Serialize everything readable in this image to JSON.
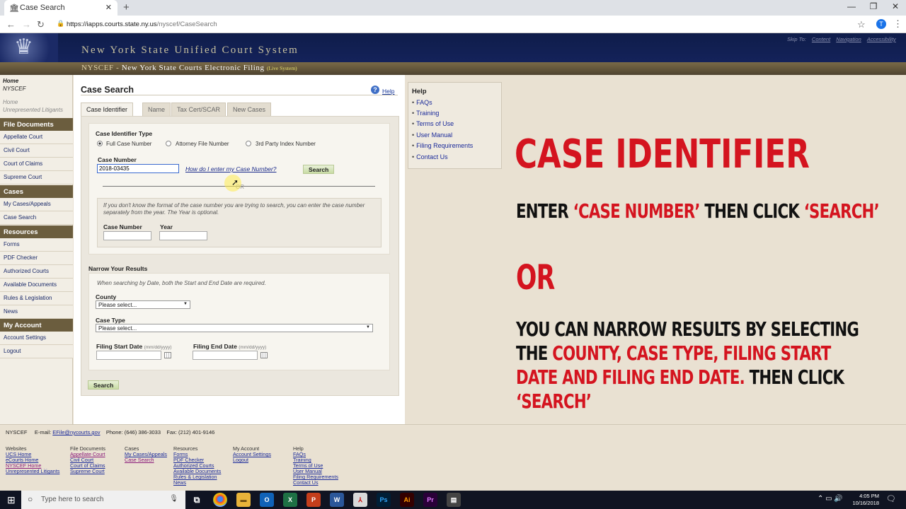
{
  "browser": {
    "tab_title": "Case Search",
    "tab_close": "✕",
    "new_tab": "+",
    "url_host": "https://iapps.courts.state.ny.us",
    "url_path": "/nyscef/CaseSearch",
    "avatar_letter": "T",
    "win_min": "—",
    "win_max": "❐",
    "win_close": "✕"
  },
  "header": {
    "site_title": "New York State Unified Court System",
    "skip_label": "Skip To:",
    "skip_links": [
      "Content",
      "Navigation",
      "Accessibility"
    ],
    "nyscef": "NYSCEF",
    "dash": " - ",
    "subtitle": "New York State Courts Electronic Filing",
    "live": "(Live System)"
  },
  "sidebar": {
    "home": "Home",
    "nyscef": "NYSCEF",
    "home2": "Home",
    "unrep": "Unrepresented Litigants",
    "sections": [
      {
        "title": "File Documents",
        "items": [
          "Appellate Court",
          "Civil Court",
          "Court of Claims",
          "Supreme Court"
        ]
      },
      {
        "title": "Cases",
        "items": [
          "My Cases/Appeals",
          "Case Search"
        ]
      },
      {
        "title": "Resources",
        "items": [
          "Forms",
          "PDF Checker",
          "Authorized Courts",
          "Available Documents",
          "Rules & Legislation",
          "News"
        ]
      },
      {
        "title": "My Account",
        "items": [
          "Account Settings",
          "Logout"
        ]
      }
    ]
  },
  "main": {
    "title": "Case Search",
    "help": "Help",
    "tabs": [
      "Case Identifier",
      "Name",
      "Tax Cert/SCAR",
      "New Cases"
    ],
    "id_type_label": "Case Identifier Type",
    "radios": [
      "Full Case Number",
      "Attorney File Number",
      "3rd Party Index Number"
    ],
    "case_number_label": "Case Number",
    "case_number_value": "2018-03435",
    "how_do": "How do I enter my Case Number?",
    "search": "Search",
    "or": "OR",
    "note": "If you don't know the format of the case number you are trying to search, you can enter the case number separately from the year. The Year is optional.",
    "case_number2": "Case Number",
    "year": "Year",
    "narrow": "Narrow Your Results",
    "narrow_note": "When searching by Date, both the Start and End Date are required.",
    "county": "County",
    "county_value": "Please select...",
    "case_type": "Case Type",
    "case_type_value": "Please select...",
    "start_date": "Filing Start Date",
    "end_date": "Filing End Date",
    "date_hint": "(mm/dd/yyyy)",
    "search_bottom": "Search"
  },
  "help_box": {
    "title": "Help",
    "links": [
      "FAQs",
      "Training",
      "Terms of Use",
      "User Manual",
      "Filing Requirements",
      "Contact Us"
    ]
  },
  "overlay": {
    "title": "CASE IDENTIFIER",
    "l1a": "ENTER ",
    "l1b": "‘CASE NUMBER’",
    "l1c": " THEN CLICK ",
    "l1d": "‘SEARCH’",
    "or": "OR",
    "p1": "YOU CAN NARROW RESULTS BY SELECTING THE ",
    "p2": "COUNTY, CASE TYPE, FILING START DATE AND FILING END DATE.",
    "p3": " THEN CLICK ",
    "p4": "‘SEARCH’"
  },
  "footer": {
    "nyscef": "NYSCEF",
    "email_label": "E-mail:",
    "email": "EFile@nycourts.gov",
    "phone": "Phone: (646) 386-3033",
    "fax": "Fax: (212) 401-9146",
    "cols": [
      {
        "h": "Websites",
        "links": [
          "UCS Home",
          "eCourts Home",
          "NYSCEF Home",
          "Unrepresented Litigants"
        ]
      },
      {
        "h": "File Documents",
        "links": [
          "Appellate Court",
          "Civil Court",
          "Court of Claims",
          "Supreme Court"
        ]
      },
      {
        "h": "Cases",
        "links": [
          "My Cases/Appeals",
          "Case Search"
        ]
      },
      {
        "h": "Resources",
        "links": [
          "Forms",
          "PDF Checker",
          "Authorized Courts",
          "Available Documents",
          "Rules & Legislation",
          "News"
        ]
      },
      {
        "h": "My Account",
        "links": [
          "Account Settings",
          "Logout"
        ]
      },
      {
        "h": "Help",
        "links": [
          "FAQs",
          "Training",
          "Terms of Use",
          "User Manual",
          "Filing Requirements",
          "Contact Us"
        ]
      }
    ]
  },
  "taskbar": {
    "search_placeholder": "Type here to search",
    "time": "4:05 PM",
    "date": "10/16/2018",
    "notif_count": "2"
  }
}
